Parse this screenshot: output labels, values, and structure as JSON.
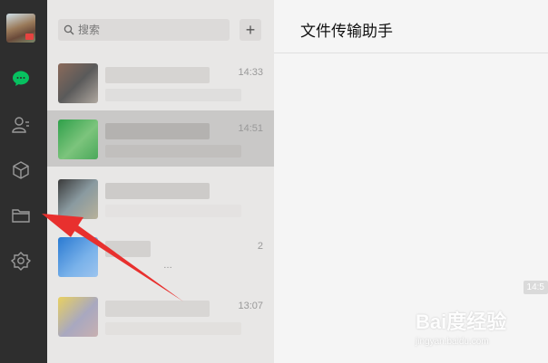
{
  "search": {
    "placeholder": "搜索"
  },
  "rail": {
    "icons": [
      "chat-icon",
      "contacts-icon",
      "cube-icon",
      "folder-icon",
      "settings-icon"
    ]
  },
  "chats": [
    {
      "time": "14:33",
      "preview": ""
    },
    {
      "time": "14:51",
      "preview": ""
    },
    {
      "time": "",
      "preview": ""
    },
    {
      "time": "2",
      "preview": "…"
    },
    {
      "time": "13:07",
      "preview": ""
    }
  ],
  "main": {
    "title": "文件传输助手",
    "message_time": "14:5"
  },
  "watermark": {
    "text": "Bai度经验",
    "url": "jingyan.baidu.com"
  },
  "colors": {
    "rail": "#2e2e2e",
    "active_chat": "#07c160",
    "arrow": "#e8302e"
  }
}
